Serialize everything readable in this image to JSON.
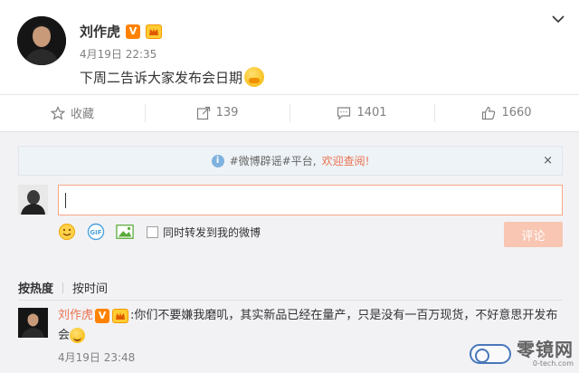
{
  "post": {
    "author": "刘作虎",
    "verified_badge": "V",
    "time": "4月19日 22:35",
    "text": "下周二告诉大家发布会日期",
    "menu_icon": "chevron-down-icon"
  },
  "actions": {
    "favorite_label": "收藏",
    "repost_count": "139",
    "comment_count": "1401",
    "like_count": "1660"
  },
  "comments": {
    "notice_prefix": "#微博辟谣#平台,",
    "notice_link": "欢迎查阅!",
    "notice_close": "×",
    "input_value": "",
    "sync_label": "同时转发到我的微博",
    "submit_label": "评论",
    "sort_hot": "按热度",
    "sort_time": "按时间",
    "list": [
      {
        "author": "刘作虎",
        "text": ":你们不要嫌我磨叽，其实新品已经在量产，只是没有一百万现货，不好意思开发布会",
        "time": "4月19日 23:48"
      }
    ]
  },
  "watermark": {
    "cn": "零镜网",
    "en": "0-tech.com"
  },
  "colors": {
    "accent": "#eb7350",
    "verified": "#ff8200",
    "submit_disabled": "#f8c6b2"
  }
}
